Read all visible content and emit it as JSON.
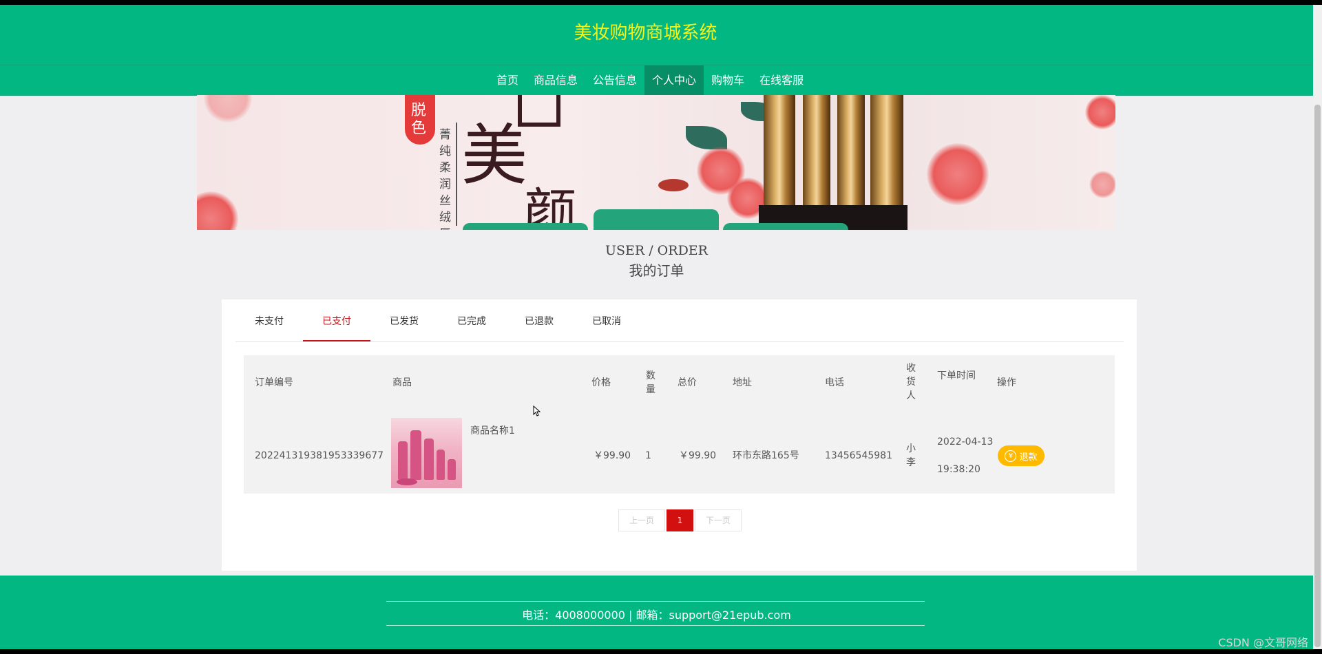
{
  "header": {
    "title": "美妆购物商城系统"
  },
  "nav": {
    "items": [
      "首页",
      "商品信息",
      "公告信息",
      "个人中心",
      "购物车",
      "在线客服"
    ],
    "active": "个人中心"
  },
  "banner": {
    "tag_text": "脱色",
    "big_text_1": "美",
    "big_text_2": "颜",
    "vertical_text": "菁纯柔润丝绒唇"
  },
  "section": {
    "title_en": "USER / ORDER",
    "title_cn": "我的订单"
  },
  "tabs": [
    "未支付",
    "已支付",
    "已发货",
    "已完成",
    "已退款",
    "已取消"
  ],
  "active_tab": "已支付",
  "table": {
    "headers": {
      "order_no": "订单编号",
      "product": "商品",
      "price": "价格",
      "qty": "数量",
      "total": "总价",
      "address": "地址",
      "phone": "电话",
      "receiver": "收货人",
      "time": "下单时间",
      "action": "操作"
    },
    "rows": [
      {
        "order_no": "202241319381953339677",
        "product_name": "商品名称1",
        "price": "￥99.90",
        "qty": "1",
        "total": "￥99.90",
        "address": "环市东路165号",
        "phone": "13456545981",
        "receiver": "小李",
        "time_date": "2022-04-13",
        "time_clock": "19:38:20",
        "action_label": "退款"
      }
    ]
  },
  "pager": {
    "prev": "上一页",
    "current": "1",
    "next": "下一页"
  },
  "footer": {
    "text": "电话：4008000000 | 邮箱：support@21epub.com"
  },
  "watermark": "CSDN @文哥网络",
  "colors": {
    "primary_green": "#03b783",
    "title_yellow": "#f5f21a",
    "active_red": "#c4161c",
    "refund_orange": "#ffba00"
  }
}
